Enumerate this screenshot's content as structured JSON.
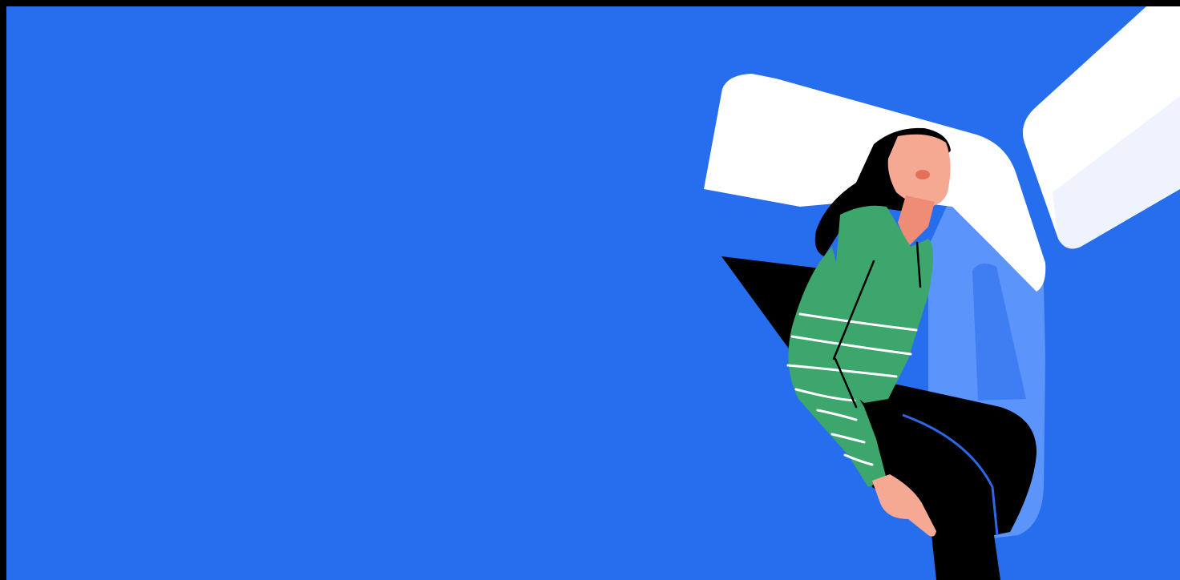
{
  "hero": {
    "colors": {
      "background": "#276EEE",
      "frame": "#000000",
      "pillow": "#FFFFFF",
      "window_shade": "#EEF3FD",
      "seat": "#5B94FA",
      "seat_shadow": "#3F7DF2",
      "skin": "#F5A993",
      "skin_shadow": "#EE8C75",
      "hair": "#000000",
      "sweater": "#3DA66C",
      "stripe": "#FFFFFF",
      "pants": "#000000",
      "pants_seam": "#2C68E6",
      "lips": "#E4705B"
    },
    "illustration": {
      "subject": "woman-sleeping-in-seat",
      "elements": [
        "pillow-icon",
        "window-icon",
        "seat-icon",
        "person-icon"
      ]
    }
  }
}
